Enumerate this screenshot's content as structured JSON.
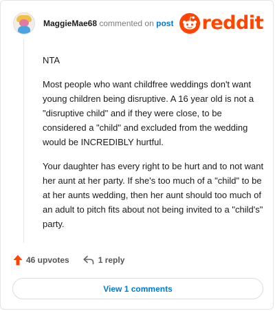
{
  "comment": {
    "username": "MaggieMae68",
    "action_text": "commented on",
    "post_link": "post",
    "brand": "reddit",
    "paragraphs": [
      "NTA",
      "Most people who want childfree weddings don't want young children being disruptive. A 16 year old is not a \"disruptive child\" and if they were close, to be considered a \"child\" and excluded from the wedding would be INCREDIBLY hurtful.",
      "Your daughter has every right to be hurt and to not want her aunt at her party. If she's too much of a \"child\" to be at her aunts wedding, then her aunt should too much of an adult to pitch fits about not being invited to a \"child's\" party."
    ]
  },
  "actions": {
    "upvotes_label": "46 upvotes",
    "reply_label": "1 reply",
    "view_comments_label": "View 1 comments"
  },
  "colors": {
    "brand_orange": "#ff4500",
    "link_blue": "#0079d3"
  },
  "icons": {
    "upvote": "upvote-arrow-icon",
    "reply": "reply-arrow-icon",
    "logo": "reddit-snoo-icon"
  }
}
